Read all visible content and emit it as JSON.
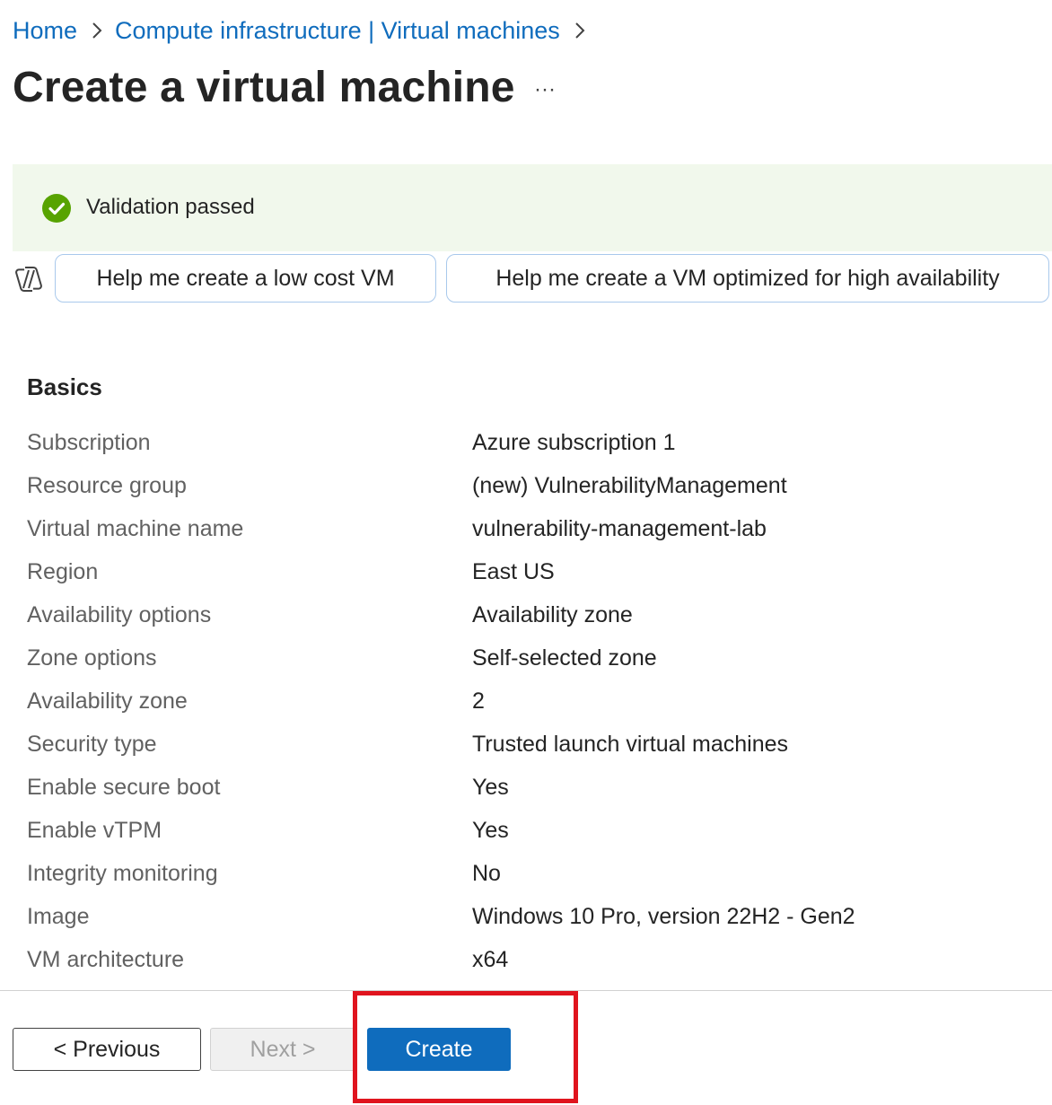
{
  "breadcrumb": {
    "items": [
      "Home",
      "Compute infrastructure | Virtual machines"
    ]
  },
  "page": {
    "title": "Create a virtual machine",
    "more_label": "···"
  },
  "validation": {
    "message": "Validation passed",
    "status_color": "#57a300"
  },
  "copilot": {
    "icon": "copilot-icon",
    "suggestions": [
      "Help me create a low cost VM",
      "Help me create a VM optimized for high availability"
    ]
  },
  "basics": {
    "heading": "Basics",
    "rows": [
      {
        "label": "Subscription",
        "value": "Azure subscription 1"
      },
      {
        "label": "Resource group",
        "value": "(new) VulnerabilityManagement"
      },
      {
        "label": "Virtual machine name",
        "value": "vulnerability-management-lab"
      },
      {
        "label": "Region",
        "value": "East US"
      },
      {
        "label": "Availability options",
        "value": "Availability zone"
      },
      {
        "label": "Zone options",
        "value": "Self-selected zone"
      },
      {
        "label": "Availability zone",
        "value": "2"
      },
      {
        "label": "Security type",
        "value": "Trusted launch virtual machines"
      },
      {
        "label": "Enable secure boot",
        "value": "Yes"
      },
      {
        "label": "Enable vTPM",
        "value": "Yes"
      },
      {
        "label": "Integrity monitoring",
        "value": "No"
      },
      {
        "label": "Image",
        "value": "Windows 10 Pro, version 22H2 - Gen2"
      },
      {
        "label": "VM architecture",
        "value": "x64"
      }
    ]
  },
  "footer": {
    "previous_label": "< Previous",
    "next_label": "Next >",
    "create_label": "Create",
    "accent_color": "#0f6cbd",
    "highlight_color": "#e0141e"
  }
}
